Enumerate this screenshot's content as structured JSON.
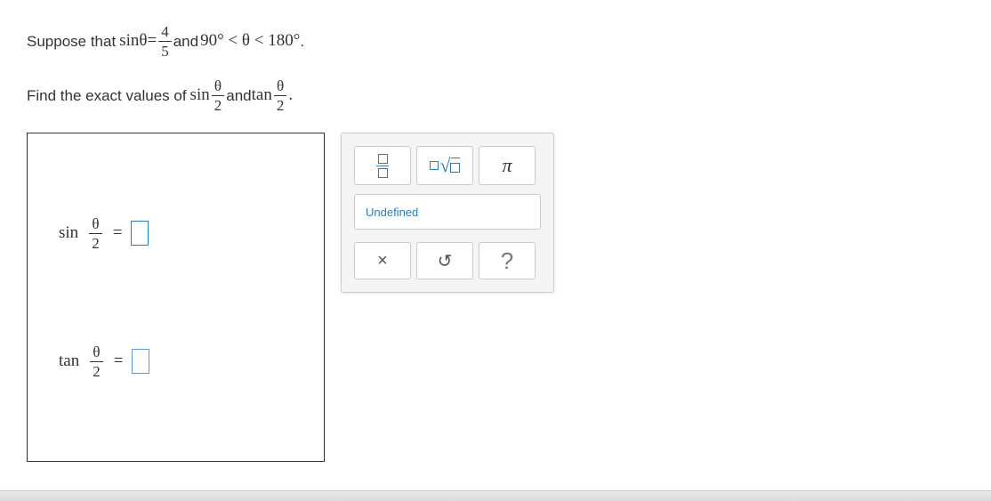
{
  "problem": {
    "l1a": "Suppose that ",
    "sin_th": "sinθ",
    "eq": " = ",
    "f1n": "4",
    "f1d": "5",
    "l1b": " and ",
    "range": "90° < θ < 180°",
    "period": ".",
    "l2a": "Find the exact values of ",
    "sin": "sin",
    "th": "θ",
    "two": "2",
    "and": " and ",
    "tan": "tan"
  },
  "answers": {
    "sin_label": "sin",
    "tan_label": "tan",
    "th": "θ",
    "two": "2",
    "eq": "="
  },
  "tools": {
    "undefined": "Undefined",
    "pi": "π",
    "close": "×",
    "reset": "↺",
    "help": "?"
  }
}
